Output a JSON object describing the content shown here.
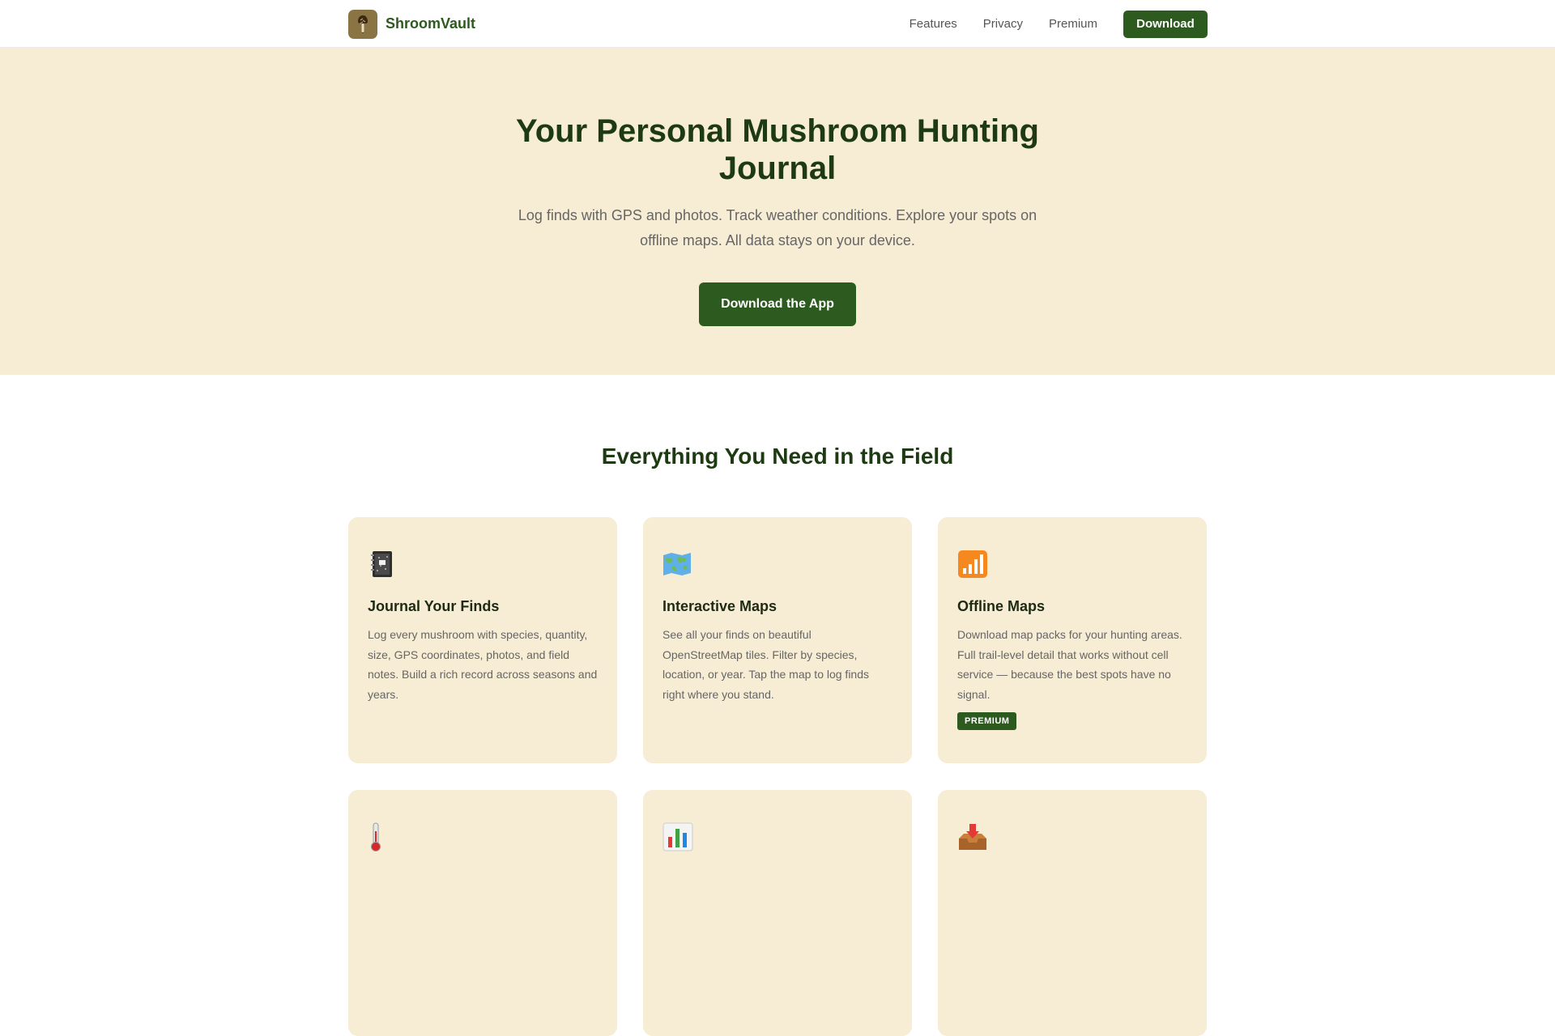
{
  "brand": {
    "name": "ShroomVault",
    "logo_icon": "mushroom-icon",
    "logo_color": "#8a7444"
  },
  "nav": {
    "links": [
      "Features",
      "Privacy",
      "Premium"
    ],
    "download_label": "Download"
  },
  "hero": {
    "title": "Your Personal Mushroom Hunting Journal",
    "subtitle": "Log finds with GPS and photos. Track weather conditions. Explore your spots on offline maps. All data stays on your device.",
    "cta_label": "Download the App",
    "background_color": "#f7ecd4"
  },
  "features": {
    "title": "Everything You Need in the Field",
    "cards": [
      {
        "icon": "notebook-icon",
        "title": "Journal Your Finds",
        "description": "Log every mushroom with species, quantity, size, GPS coordinates, photos, and field notes. Build a rich record across seasons and years.",
        "badge": ""
      },
      {
        "icon": "world-map-icon",
        "title": "Interactive Maps",
        "description": "See all your finds on beautiful OpenStreetMap tiles. Filter by species, location, or year. Tap the map to log finds right where you stand.",
        "badge": ""
      },
      {
        "icon": "signal-bars-icon",
        "title": "Offline Maps",
        "description": "Download map packs for your hunting areas. Full trail-level detail that works without cell service — because the best spots have no signal.",
        "badge": "PREMIUM"
      },
      {
        "icon": "thermometer-icon",
        "title": "",
        "description": "",
        "badge": ""
      },
      {
        "icon": "bar-chart-icon",
        "title": "",
        "description": "",
        "badge": ""
      },
      {
        "icon": "inbox-tray-icon",
        "title": "",
        "description": "",
        "badge": ""
      }
    ]
  },
  "colors": {
    "primary": "#2d5a1e",
    "heading": "#1e3a12",
    "cream": "#f7ecd4"
  }
}
